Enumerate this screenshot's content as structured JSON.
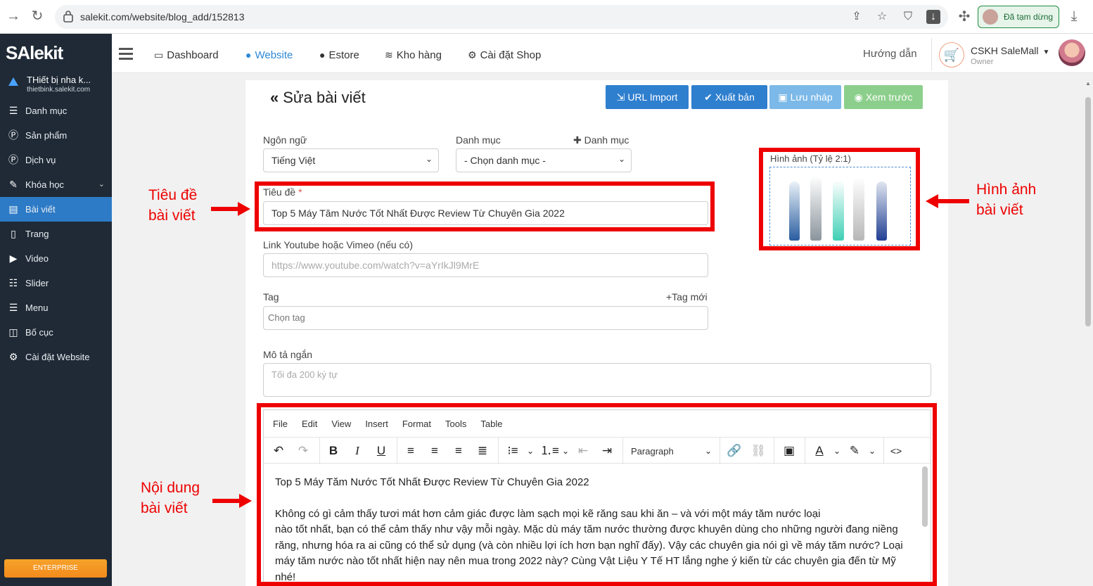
{
  "browser": {
    "url": "salekit.com/website/blog_add/152813",
    "profile_status": "Đã tạm dừng"
  },
  "sidebar": {
    "logo": "SAlekit",
    "shop_name": "THiết bị nha k...",
    "shop_domain": "thietbink.salekit.com",
    "items": [
      {
        "label": "Danh mục",
        "icon": "list-icon"
      },
      {
        "label": "Sản phẩm",
        "icon": "product-icon"
      },
      {
        "label": "Dịch vụ",
        "icon": "service-icon"
      },
      {
        "label": "Khóa học",
        "icon": "book-icon"
      },
      {
        "label": "Bài viết",
        "icon": "newspaper-icon"
      },
      {
        "label": "Trang",
        "icon": "page-icon"
      },
      {
        "label": "Video",
        "icon": "video-icon"
      },
      {
        "label": "Slider",
        "icon": "sliders-icon"
      },
      {
        "label": "Menu",
        "icon": "menu-icon"
      },
      {
        "label": "Bố cục",
        "icon": "layout-icon"
      },
      {
        "label": "Cài đặt Website",
        "icon": "gear-icon"
      }
    ],
    "badge": "ENTERPRISE"
  },
  "topnav": {
    "items": [
      "Dashboard",
      "Website",
      "Estore",
      "Kho hàng",
      "Cài đặt Shop"
    ],
    "help": "Hướng dẫn",
    "user_name": "CSKH SaleMall",
    "user_role": "Owner"
  },
  "page": {
    "title": "Sửa bài viết",
    "buttons": {
      "url_import": "URL Import",
      "publish": "Xuất bản",
      "save_draft": "Lưu nháp",
      "preview": "Xem trước"
    },
    "language_label": "Ngôn ngữ",
    "language_value": "Tiếng Việt",
    "category_label": "Danh mục",
    "category_add": "Danh mục",
    "category_value": "- Chọn danh mục -",
    "title_label": "Tiêu đề",
    "title_required": "*",
    "title_value": "Top 5 Máy Tăm Nước Tốt Nhất Được Review Từ Chuyên Gia 2022",
    "video_label": "Link Youtube hoặc Vimeo (nếu có)",
    "video_placeholder": "https://www.youtube.com/watch?v=aYrIkJl9MrE",
    "tag_label": "Tag",
    "tag_new": "+Tag mới",
    "tag_placeholder": "Chọn tag",
    "desc_label": "Mô tả ngắn",
    "desc_placeholder": "Tối đa 200 ký tự",
    "image_label": "Hình ảnh (Tỷ lệ 2:1)"
  },
  "editor": {
    "menus": [
      "File",
      "Edit",
      "View",
      "Insert",
      "Format",
      "Tools",
      "Table"
    ],
    "block_format": "Paragraph",
    "heading": "Top 5 Máy Tăm Nước Tốt Nhất Được Review Từ Chuyên Gia 2022",
    "body_line1": "Không có gì cảm thấy tươi mát hơn cảm giác được làm sạch mọi kẽ răng sau khi ăn – và với một máy tăm nước loại",
    "body_rest": "nào tốt nhất, bạn có thể cảm thấy như vậy mỗi ngày. Mặc dù máy tăm nước thường được khuyên dùng cho những người đang niềng răng, nhưng hóa ra ai cũng có thể sử dụng (và còn nhiều lợi ích hơn bạn nghĩ đấy). Vậy các chuyên gia nói gì về máy tăm nước? Loại máy tăm nước nào tốt nhất hiện nay nên mua trong 2022 này? Cùng Vật Liệu Y Tế HT lắng nghe ý kiến từ các chuyên gia đến từ Mỹ nhé!"
  },
  "annotations": {
    "title_note_1": "Tiêu đề",
    "title_note_2": "bài viết",
    "image_note_1": "Hình ảnh",
    "image_note_2": "bài viết",
    "content_note_1": "Nội dung",
    "content_note_2": "bài viết"
  },
  "colors": {
    "annotation": "#ee0000",
    "primary": "#2f7fcf",
    "sidebar": "#1f2a36"
  }
}
